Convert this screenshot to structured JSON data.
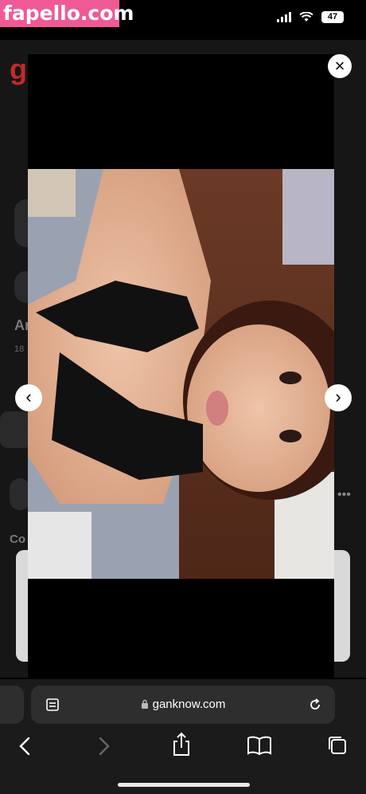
{
  "watermark": "fapello.com",
  "status_bar": {
    "battery": "47",
    "wifi_icon": "wifi-icon",
    "signal_icon": "cellular-signal-icon"
  },
  "background_page": {
    "logo": "g",
    "name_partial": "Ar",
    "count_partial": "18",
    "section_partial": "Co"
  },
  "lightbox": {
    "close_label": "×",
    "prev_label": "‹",
    "next_label": "›"
  },
  "browser": {
    "url": "ganknow.com",
    "lock_icon": "lock-icon",
    "reader_icon": "reader-mode-icon",
    "reload_icon": "reload-icon",
    "toolbar": [
      "back-icon",
      "forward-icon",
      "share-icon",
      "bookmarks-icon",
      "tabs-icon"
    ]
  }
}
